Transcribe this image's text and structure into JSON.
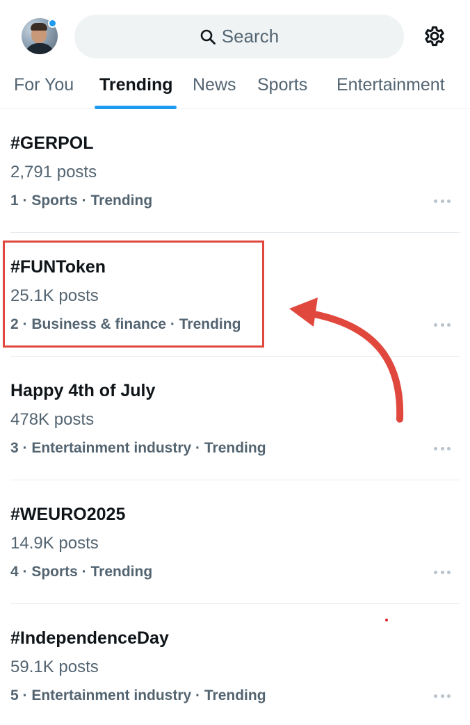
{
  "header": {
    "search_placeholder": "Search",
    "avatar_icon": "user-avatar",
    "settings_icon": "gear-icon",
    "search_icon": "search-icon"
  },
  "tabs": [
    {
      "label": "For You",
      "active": false
    },
    {
      "label": "Trending",
      "active": true
    },
    {
      "label": "News",
      "active": false
    },
    {
      "label": "Sports",
      "active": false
    },
    {
      "label": "Entertainment",
      "active": false
    }
  ],
  "trends": [
    {
      "title": "#GERPOL",
      "count": "2,791 posts",
      "meta": "1 · Sports · Trending"
    },
    {
      "title": "#FUNToken",
      "count": "25.1K posts",
      "meta": "2 · Business & finance · Trending"
    },
    {
      "title": "Happy 4th of July",
      "count": "478K posts",
      "meta": "3 · Entertainment industry · Trending"
    },
    {
      "title": "#WEURO2025",
      "count": "14.9K posts",
      "meta": "4 · Sports · Trending"
    },
    {
      "title": "#IndependenceDay",
      "count": "59.1K posts",
      "meta": "5 · Entertainment industry · Trending"
    }
  ],
  "annotation": {
    "highlighted_trend": "#FUNToken",
    "color": "#e0483e"
  },
  "colors": {
    "accent": "#1d9bf0",
    "text_primary": "#0f1419",
    "text_secondary": "#536471",
    "search_bg": "#eff3f4"
  }
}
